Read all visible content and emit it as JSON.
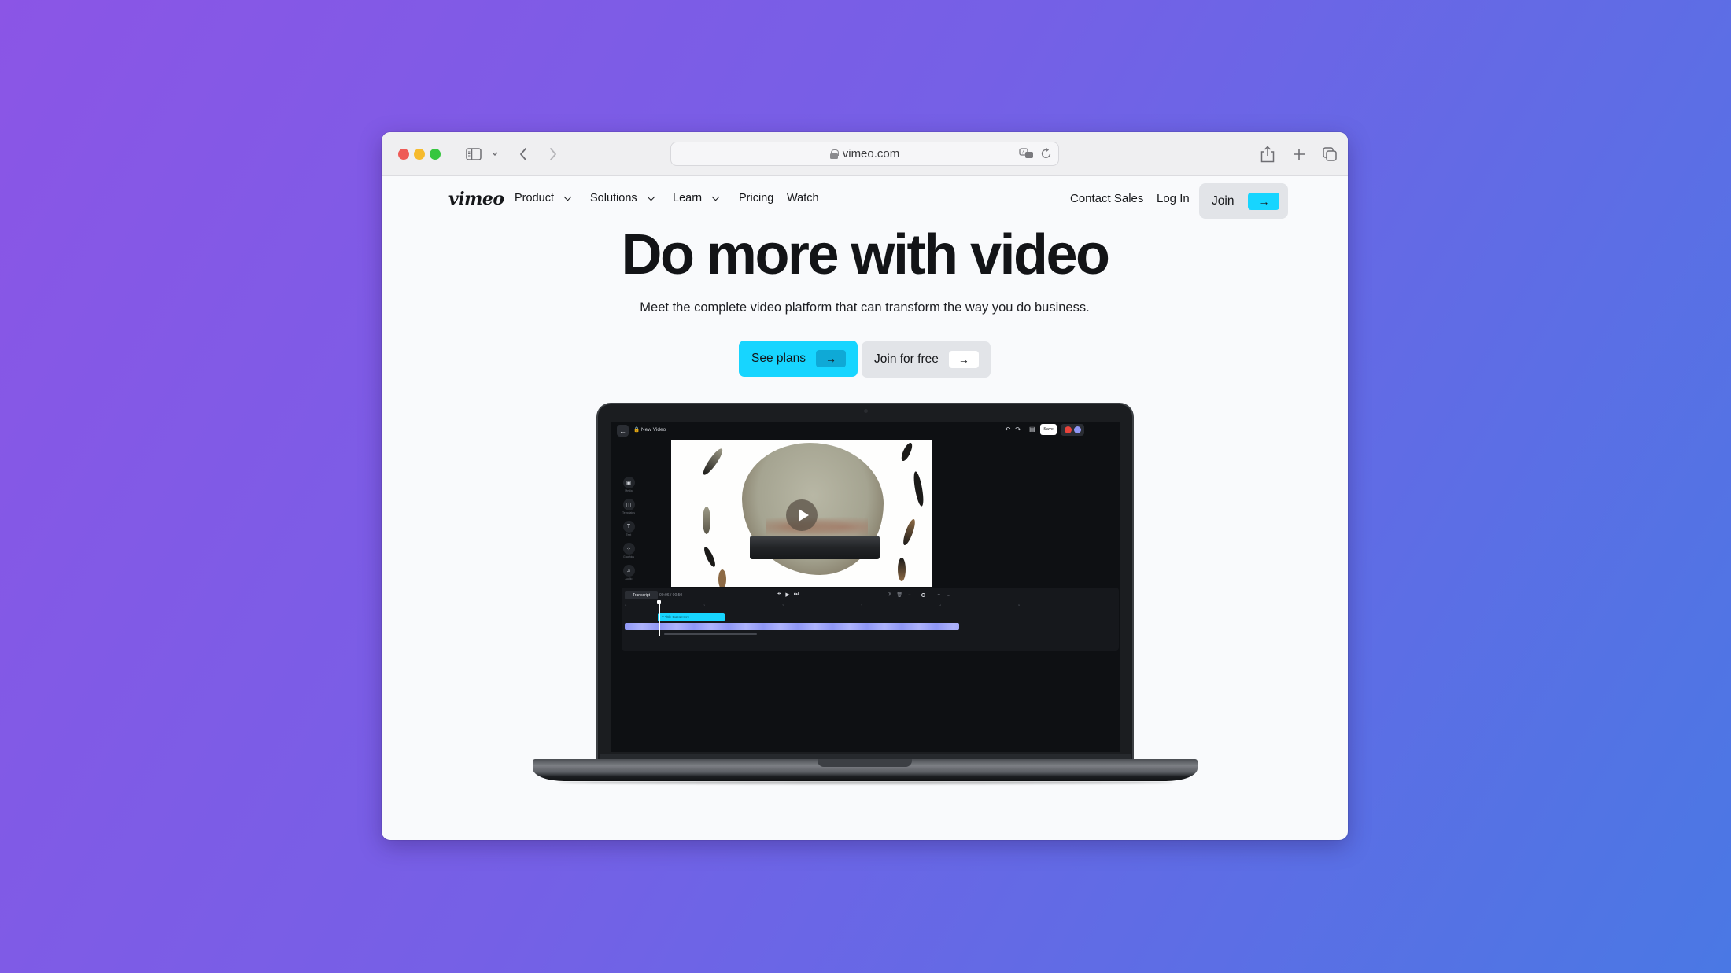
{
  "browser": {
    "url": "vimeo.com",
    "controls": {
      "close_color": "#ee5b57",
      "minimize_color": "#f6bb2e",
      "maximize_color": "#36c63f"
    }
  },
  "nav": {
    "logo": "vimeo",
    "items": [
      {
        "label": "Product",
        "has_dropdown": true
      },
      {
        "label": "Solutions",
        "has_dropdown": true
      },
      {
        "label": "Learn",
        "has_dropdown": true
      },
      {
        "label": "Pricing",
        "has_dropdown": false
      },
      {
        "label": "Watch",
        "has_dropdown": false
      }
    ],
    "contact_sales": "Contact Sales",
    "log_in": "Log In",
    "join": "Join",
    "arrow": "→"
  },
  "hero": {
    "headline": "Do more with video",
    "subhead": "Meet the complete video platform that can transform the way you do business.",
    "primary_cta": "See plans",
    "secondary_cta": "Join for free",
    "arrow": "→"
  },
  "colors": {
    "accent_cyan": "#17d5ff",
    "button_gray": "#e2e4e8",
    "gradient_start": "#8b55e6",
    "gradient_end": "#4a78e4"
  },
  "editor": {
    "title": "New Video",
    "save": "Save",
    "sidebar": [
      {
        "label": "Media",
        "icon": "image-icon"
      },
      {
        "label": "Templates",
        "icon": "layout-icon"
      },
      {
        "label": "Text",
        "icon": "text-icon"
      },
      {
        "label": "Graphics",
        "icon": "shapes-icon"
      },
      {
        "label": "Audio",
        "icon": "music-icon"
      }
    ],
    "timeline": {
      "transcript": "Transcript",
      "time": "00:06 / 00:50",
      "ruler": [
        "0",
        "1",
        "2",
        "3",
        "4",
        "5"
      ],
      "title_clip": "T  Title Goes Here"
    }
  }
}
